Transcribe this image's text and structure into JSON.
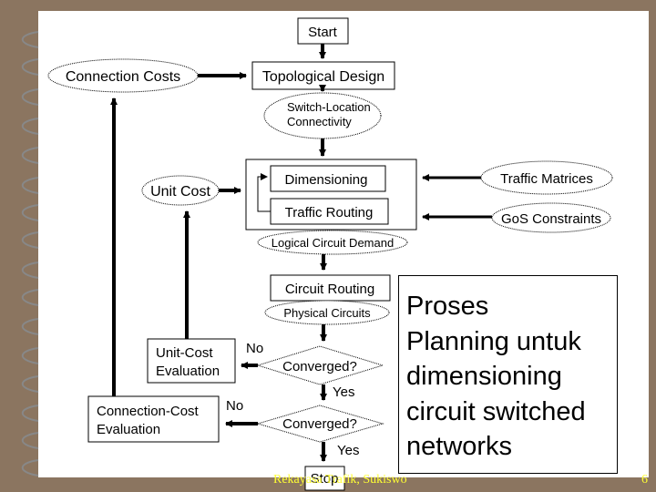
{
  "diagram": {
    "start": "Start",
    "topological_design": "Topological Design",
    "connection_costs": "Connection Costs",
    "switch_location": [
      "Switch-Location",
      "Connectivity"
    ],
    "unit_cost": "Unit Cost",
    "dimensioning": "Dimensioning",
    "traffic_routing": "Traffic Routing",
    "traffic_matrices": "Traffic Matrices",
    "gos_constraints": "GoS Constraints",
    "logical_circuit_demand": "Logical Circuit Demand",
    "circuit_routing": "Circuit Routing",
    "physical_circuits": "Physical Circuits",
    "converged_1": "Converged?",
    "converged_2": "Converged?",
    "unit_cost_evaluation": [
      "Unit-Cost",
      "Evaluation"
    ],
    "connection_cost_evaluation": [
      "Connection-Cost",
      "Evaluation"
    ],
    "no_1": "No",
    "no_2": "No",
    "yes_1": "Yes",
    "yes_2": "Yes",
    "stop": "Stop"
  },
  "note": [
    "Proses",
    "Planning untuk",
    "dimensioning",
    "circuit switched",
    "networks"
  ],
  "footer": "Rekayasa Trafik, Sukiswo",
  "page_number": "6",
  "colors": {
    "background": "#8b7560",
    "footer_text": "#ffff33"
  }
}
